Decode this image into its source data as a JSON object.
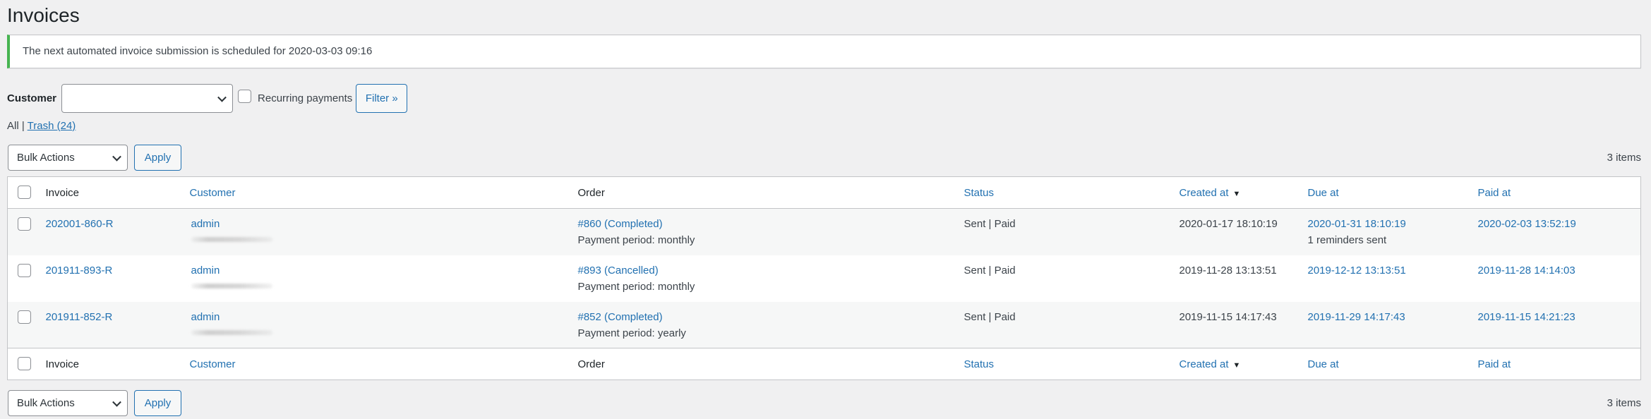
{
  "page": {
    "title": "Invoices"
  },
  "notice": {
    "text": "The next automated invoice submission is scheduled for 2020-03-03 09:16",
    "accent_color": "#46b450"
  },
  "filters": {
    "customer_label": "Customer",
    "customer_value": "",
    "recurring_label": "Recurring payments",
    "recurring_checked": false,
    "filter_button": "Filter »"
  },
  "views": {
    "all_label": "All",
    "separator": "|",
    "trash_label": "Trash (24)"
  },
  "tablenav": {
    "bulk_actions": "Bulk Actions",
    "apply": "Apply",
    "count": "3 items"
  },
  "table": {
    "columns": {
      "invoice": "Invoice",
      "customer": "Customer",
      "order": "Order",
      "status": "Status",
      "created_at": "Created at",
      "sort_indicator": "▼",
      "due_at": "Due at",
      "paid_at": "Paid at"
    },
    "rows": [
      {
        "invoice": "202001-860-R",
        "customer": "admin",
        "customer_email": "[redacted]",
        "order": "#860 (Completed)",
        "payment_period": "Payment period: monthly",
        "status": "Sent | Paid",
        "created_at": "2020-01-17 18:10:19",
        "due_at": "2020-01-31 18:10:19",
        "due_note": "1 reminders sent",
        "paid_at": "2020-02-03 13:52:19"
      },
      {
        "invoice": "201911-893-R",
        "customer": "admin",
        "customer_email": "[redacted]",
        "order": "#893 (Cancelled)",
        "payment_period": "Payment period: monthly",
        "status": "Sent | Paid",
        "created_at": "2019-11-28 13:13:51",
        "due_at": "2019-12-12 13:13:51",
        "due_note": "",
        "paid_at": "2019-11-28 14:14:03"
      },
      {
        "invoice": "201911-852-R",
        "customer": "admin",
        "customer_email": "[redacted]",
        "order": "#852 (Completed)",
        "payment_period": "Payment period: yearly",
        "status": "Sent | Paid",
        "created_at": "2019-11-15 14:17:43",
        "due_at": "2019-11-29 14:17:43",
        "due_note": "",
        "paid_at": "2019-11-15 14:21:23"
      }
    ]
  }
}
